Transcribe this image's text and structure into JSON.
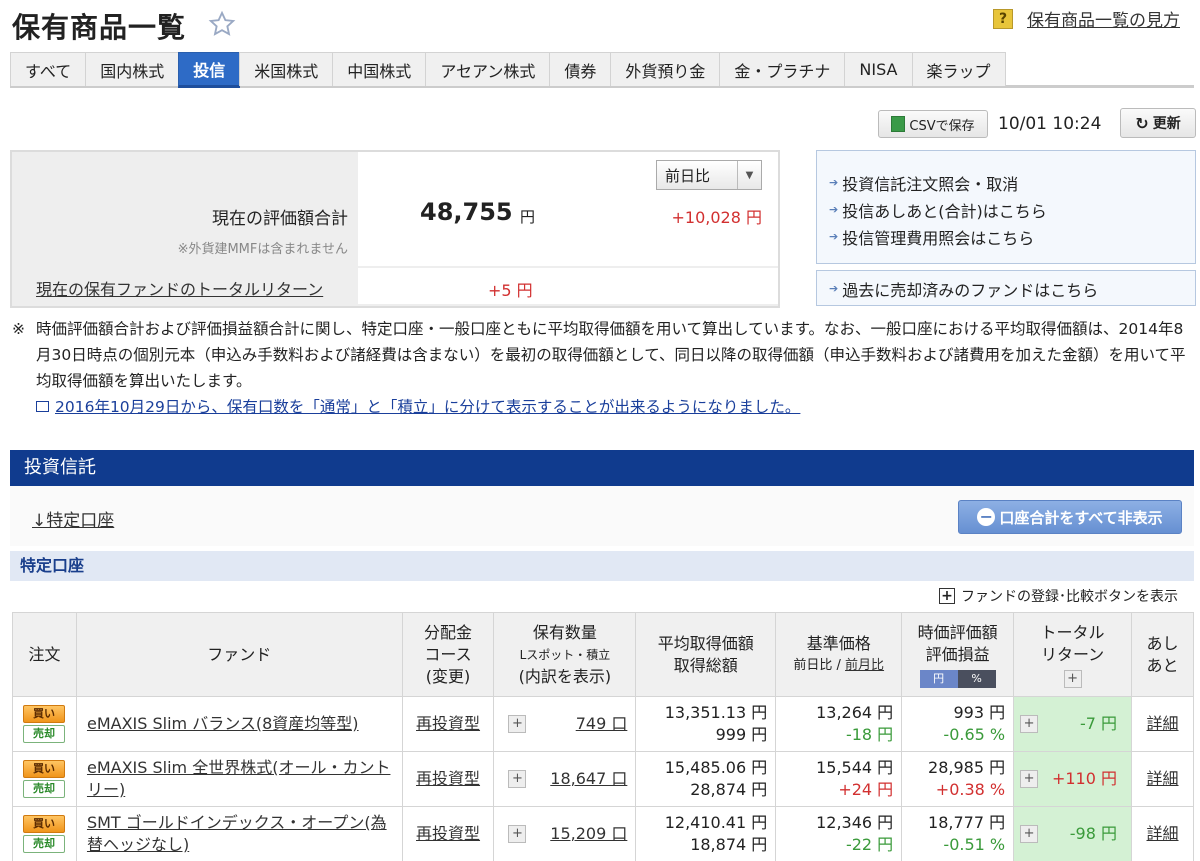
{
  "header": {
    "title": "保有商品一覧",
    "help_label": "保有商品一覧の見方",
    "help_icon_text": "?"
  },
  "tabs": [
    {
      "label": "すべて"
    },
    {
      "label": "国内株式"
    },
    {
      "label": "投信"
    },
    {
      "label": "米国株式"
    },
    {
      "label": "中国株式"
    },
    {
      "label": "アセアン株式"
    },
    {
      "label": "債券"
    },
    {
      "label": "外貨預り金"
    },
    {
      "label": "金・プラチナ"
    },
    {
      "label": "NISA"
    },
    {
      "label": "楽ラップ"
    }
  ],
  "active_tab": "投信",
  "toolbar": {
    "csv_label": "CSVで保存",
    "timestamp": "10/01 10:24",
    "refresh_label": "更新",
    "refresh_icon": "↻"
  },
  "summary": {
    "eval_label": "現在の評価額合計",
    "mmf_note": "※外貨建MMFは含まれません",
    "eval_value": "48,755",
    "eval_unit": "円",
    "compare_selected": "前日比",
    "diff_value": "+10,028 円",
    "total_return_label": "現在の保有ファンドのトータルリターン",
    "total_return_value": "+5 円"
  },
  "side_links": [
    {
      "label": "投資信託注文照会・取消"
    },
    {
      "label": "投信あしあと(合計)はこちら"
    },
    {
      "label": "投信管理費用照会はこちら"
    }
  ],
  "side_link_bottom": "過去に売却済みのファンドはこちら",
  "note": {
    "mark": "※",
    "text": "時価評価額合計および評価損益額合計に関し、特定口座・一般口座ともに平均取得価額を用いて算出しています。なお、一般口座における平均取得価額は、2014年8月30日時点の個別元本（申込み手数料および諸経費は含まない）を最初の取得価額として、同日以降の取得価額（申込手数料および諸費用を加えた金額）を用いて平均取得価額を算出いたします。",
    "link": "2016年10月29日から、保有口数を「通常」と「積立」に分けて表示することが出来るようになりました。"
  },
  "section": {
    "title": "投資信託",
    "account_anchor": "↓特定口座",
    "hide_all_label": "口座合計をすべて非表示",
    "subsection_title": "特定口座",
    "compare_toggle_label": "ファンドの登録･比較ボタンを表示"
  },
  "table": {
    "headers": {
      "order": "注文",
      "fund": "ファンド",
      "dist_1": "分配金",
      "dist_2": "コース",
      "dist_3": "(変更)",
      "qty_1": "保有数量",
      "qty_2": "Lスポット・積立",
      "qty_3": "(内訳を表示)",
      "avg_1": "平均取得価額",
      "avg_2": "取得総額",
      "base_1": "基準価格",
      "base_2a": "前日比",
      "base_2sep": " / ",
      "base_2b": "前月比",
      "mkt_1": "時価評価額",
      "mkt_2": "評価損益",
      "toggle_yen": "円",
      "toggle_pct": "%",
      "ret_1": "トータル",
      "ret_2": "リターン",
      "foot_1": "あし",
      "foot_2": "あと"
    },
    "buy_label": "買い",
    "sell_label": "売却",
    "detail_label": "詳細",
    "rows": [
      {
        "fund": "eMAXIS Slim バランス(8資産均等型)",
        "course": "再投資型",
        "qty": "749 口",
        "avg_price": "13,351.13 円",
        "total_cost": "999 円",
        "base_price": "13,264 円",
        "base_diff": "-18 円",
        "market_value": "993 円",
        "pl_pct": "-0.65 %",
        "total_return": "-7 円"
      },
      {
        "fund": "eMAXIS Slim 全世界株式(オール・カントリー)",
        "course": "再投資型",
        "qty": "18,647 口",
        "avg_price": "15,485.06 円",
        "total_cost": "28,874 円",
        "base_price": "15,544 円",
        "base_diff": "+24 円",
        "market_value": "28,985 円",
        "pl_pct": "+0.38 %",
        "total_return": "+110 円"
      },
      {
        "fund": "SMT ゴールドインデックス・オープン(為替ヘッジなし)",
        "course": "再投資型",
        "qty": "15,209 口",
        "avg_price": "12,410.41 円",
        "total_cost": "18,874 円",
        "base_price": "12,346 円",
        "base_diff": "-22 円",
        "market_value": "18,777 円",
        "pl_pct": "-0.51 %",
        "total_return": "-98 円"
      }
    ]
  },
  "colors": {
    "accent_blue": "#2e6bc6",
    "section_navy": "#103b8e",
    "positive_red": "#d23030",
    "negative_green": "#3a9a3a",
    "return_bg": "#d4f1d4"
  }
}
